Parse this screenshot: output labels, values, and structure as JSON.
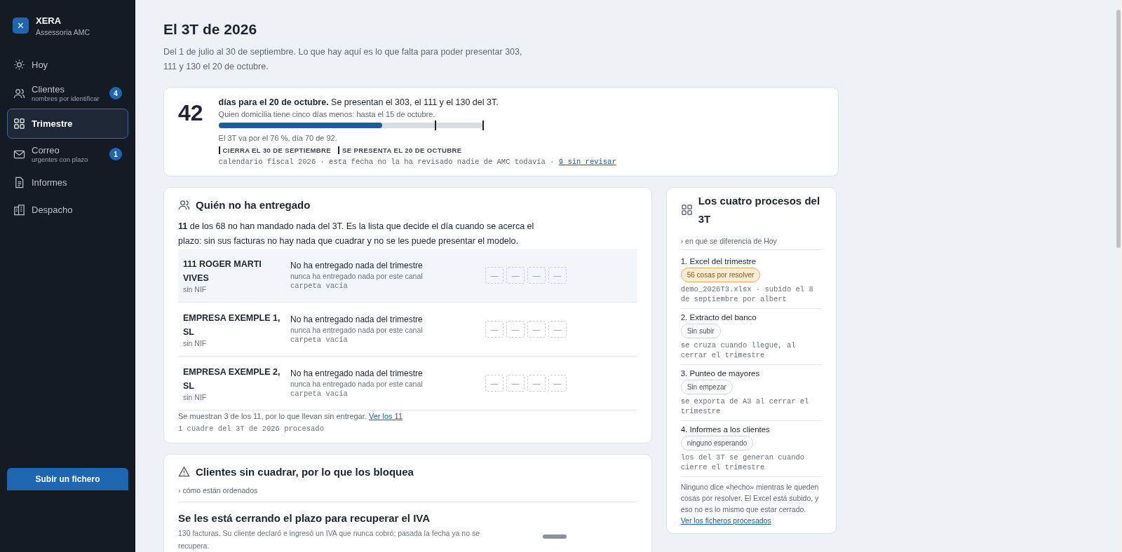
{
  "sidebar": {
    "brand": {
      "logo": "×",
      "name": "XERA",
      "subtitle": "Assessoria AMC"
    },
    "items": [
      {
        "kind": "sun",
        "label": "Hoy",
        "selected": false
      },
      {
        "kind": "people",
        "label": "Clientes",
        "sublabel": "nombres por identificar",
        "badge": "4",
        "selected": false
      },
      {
        "kind": "grid",
        "label": "Trimestre",
        "selected": true
      },
      {
        "kind": "mail",
        "label": "Correo",
        "sublabel": "urgentes con plazo",
        "badge": "1",
        "selected": false
      },
      {
        "kind": "doc",
        "label": "Informes",
        "selected": false
      },
      {
        "kind": "building",
        "label": "Despacho",
        "selected": false
      }
    ],
    "upload_button": "Subir un fichero"
  },
  "header": {
    "title": "El 3T de 2026",
    "subtitle": "Del 1 de julio al 30 de septiembre. Lo que hay aquí es lo que falta para poder presentar 303, 111 y 130 el 20 de octubre."
  },
  "deadline": {
    "days": "42",
    "headline": "**días para el 20 de octubre.** Se presentan el 303, el 111 y el 130 del 3T.",
    "note": "Quien domicilia tiene cinco días menos: hasta el 15 de octubre.",
    "progress": {
      "level": 0.62,
      "markers": [
        {
          "level": 0.82
        },
        {
          "level": 1
        }
      ]
    },
    "progress_text": "El 3T va por el 76 %, día 70 de 92.",
    "legend": [
      "CIERRA EL 30 DE SEPTIEMBRE",
      "SE PRESENTA EL 20 DE OCTUBRE"
    ],
    "source": "calendario fiscal 2026 · esta fecha no la ha revisado nadie de AMC todavía ·",
    "source_link": "9 sin revisar"
  },
  "missing": {
    "title": "Quién no ha entregado",
    "intro": "**11** de los 68 no han mandado nada del 3T. Es la lista que decide el día cuando se acerca el plazo: sin sus facturas no hay nada que cuadrar y no se les puede presentar el modelo.",
    "rows": [
      {
        "name": "111 ROGER MARTI VIVES",
        "nif": "sin NIF",
        "status": "No ha entregado nada del trimestre",
        "detail": "nunca ha entregado nada por este canal",
        "folder": "carpeta vacía",
        "slots": [
          "—",
          "—",
          "—",
          "—"
        ],
        "selected": true
      },
      {
        "name": "EMPRESA EXEMPLE 1, SL",
        "nif": "sin NIF",
        "status": "No ha entregado nada del trimestre",
        "detail": "nunca ha entregado nada por este canal",
        "folder": "carpeta vacía",
        "slots": [
          "—",
          "—",
          "—",
          "—"
        ],
        "selected": false
      },
      {
        "name": "EMPRESA EXEMPLE 2, SL",
        "nif": "sin NIF",
        "status": "No ha entregado nada del trimestre",
        "detail": "nunca ha entregado nada por este canal",
        "folder": "carpeta vacía",
        "slots": [
          "—",
          "—",
          "—",
          "—"
        ],
        "selected": false
      }
    ],
    "footer": "Se muestran 3 de los 11, por lo que llevan sin entregar.",
    "footer_link": "Ver los 11",
    "processed": "1 cuadre del 3T de 2026 procesado"
  },
  "blocked": {
    "title": "Clientes sin cuadrar, por lo que los bloquea",
    "toggle": "› cómo están ordenados",
    "group_title": "Se les está cerrando el plazo para recuperar el IVA",
    "group_text": "130 facturas. Su cliente declaró e ingresó un IVA que nunca cobró; pasada la fecha ya no se recupera."
  },
  "processes": {
    "title": "Los cuatro procesos del 3T",
    "toggle": "› en qué se diferencia de Hoy",
    "items": [
      {
        "title": "1. Excel del trimestre",
        "status": "56 cosas por resolver",
        "kind": "warning",
        "note": "demo_2026T3.xlsx · subido el 8 de septiembre por albert"
      },
      {
        "title": "2. Extracto del banco",
        "status": "Sin subir",
        "kind": "neutral",
        "note": "se cruza cuando llegue, al cerrar el trimestre"
      },
      {
        "title": "3. Punteo de mayores",
        "status": "Sin empezar",
        "kind": "neutral",
        "note": "se exporta de A3 al cerrar el trimestre"
      },
      {
        "title": "4. Informes a los clientes",
        "status": "ninguno esperando",
        "kind": "neutral",
        "note": "los del 3T se generan cuando cierre el trimestre"
      }
    ],
    "footer": "Ninguno dice «hecho» mientras le queden cosas por resolver. El Excel está subido, y eso no es lo mismo que estar cerrado.",
    "footer_link": "Ver los ficheros procesados"
  }
}
